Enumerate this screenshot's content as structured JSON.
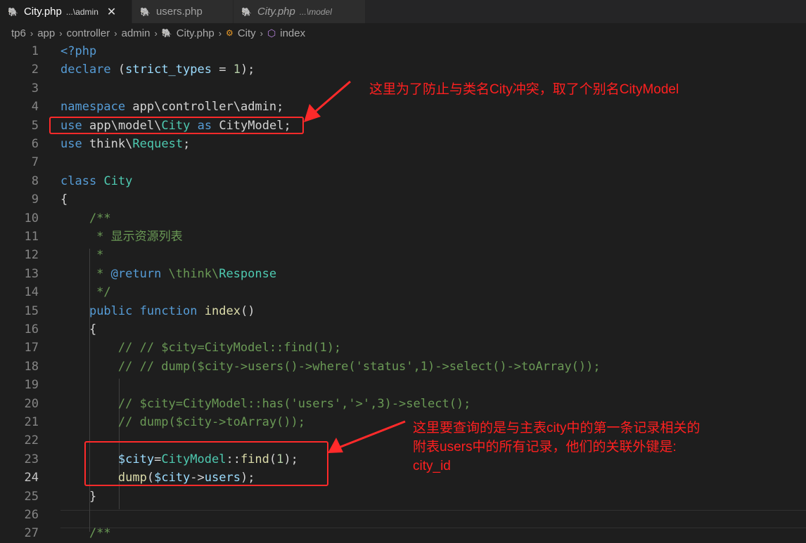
{
  "tabs": [
    {
      "name": "City.php",
      "hint": "...\\admin",
      "active": true,
      "italic": false
    },
    {
      "name": "users.php",
      "hint": "",
      "active": false,
      "italic": false
    },
    {
      "name": "City.php",
      "hint": "...\\model",
      "active": false,
      "italic": true
    }
  ],
  "tab_close_glyph": "✕",
  "breadcrumb": {
    "items": [
      "tp6",
      "app",
      "controller",
      "admin"
    ],
    "file": "City.php",
    "class": "City",
    "method": "index",
    "separator": "›"
  },
  "editor": {
    "current_line": 24,
    "lines": [
      {
        "n": "1",
        "t": "<?php"
      },
      {
        "n": "2",
        "t": "declare (strict_types = 1);"
      },
      {
        "n": "3",
        "t": ""
      },
      {
        "n": "4",
        "t": "namespace app\\controller\\admin;"
      },
      {
        "n": "5",
        "t": "use app\\model\\City as CityModel;"
      },
      {
        "n": "6",
        "t": "use think\\Request;"
      },
      {
        "n": "7",
        "t": ""
      },
      {
        "n": "8",
        "t": "class City"
      },
      {
        "n": "9",
        "t": "{"
      },
      {
        "n": "10",
        "t": "    /**"
      },
      {
        "n": "11",
        "t": "     * 显示资源列表"
      },
      {
        "n": "12",
        "t": "     *"
      },
      {
        "n": "13",
        "t": "     * @return \\think\\Response"
      },
      {
        "n": "14",
        "t": "     */"
      },
      {
        "n": "15",
        "t": "    public function index()"
      },
      {
        "n": "16",
        "t": "    {"
      },
      {
        "n": "17",
        "t": "        // // $city=CityModel::find(1);"
      },
      {
        "n": "18",
        "t": "        // // dump($city->users()->where('status',1)->select()->toArray());"
      },
      {
        "n": "19",
        "t": ""
      },
      {
        "n": "20",
        "t": "        // $city=CityModel::has('users','>',3)->select();"
      },
      {
        "n": "21",
        "t": "        // dump($city->toArray());"
      },
      {
        "n": "22",
        "t": ""
      },
      {
        "n": "23",
        "t": "        $city=CityModel::find(1);"
      },
      {
        "n": "24",
        "t": "        dump($city->users);"
      },
      {
        "n": "25",
        "t": "    }"
      },
      {
        "n": "26",
        "t": ""
      },
      {
        "n": "27",
        "t": "    /**"
      }
    ]
  },
  "annotations": {
    "note1": "这里为了防止与类名City冲突，取了个别名CityModel",
    "note2_lines": [
      "这里要查询的是与主表city中的第一条记录相关的",
      "附表users中的所有记录，他们的关联外键是:",
      "city_id"
    ]
  },
  "colors": {
    "annotation": "#ff2a2a",
    "keyword": "#569cd6",
    "comment": "#6a9955",
    "type": "#4ec9b0",
    "php_icon": "#a074c4"
  }
}
